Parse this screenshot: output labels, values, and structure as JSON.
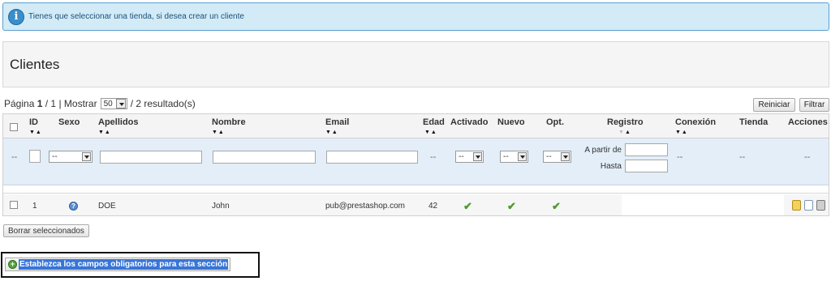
{
  "alert": {
    "icon": "info-icon",
    "text": "Tienes que seleccionar una tienda, si desea crear un cliente"
  },
  "page_title": "Clientes",
  "pagination": {
    "page_label": "Página",
    "current_page": "1",
    "total_pages": "/ 1",
    "separator": "|",
    "show_label": "Mostrar",
    "per_page": "50",
    "results": "/ 2 resultado(s)"
  },
  "toolbar": {
    "reset_label": "Reiniciar",
    "filter_label": "Filtrar"
  },
  "columns": {
    "id": "ID",
    "sex": "Sexo",
    "lastname": "Apellidos",
    "firstname": "Nombre",
    "email": "Email",
    "age": "Edad",
    "active": "Activado",
    "new": "Nuevo",
    "optin": "Opt.",
    "registration": "Registro",
    "connection": "Conexión",
    "shop": "Tienda",
    "actions": "Acciones"
  },
  "sort_arrows": "▼▲",
  "filters": {
    "dash": "--",
    "select_value": "--",
    "from_label": "A partir de",
    "to_label": "Hasta"
  },
  "rows": [
    {
      "id": "1",
      "sex_icon": "question-icon",
      "lastname": "DOE",
      "firstname": "John",
      "email": "pub@prestashop.com",
      "age": "42",
      "active_icon": "check-icon",
      "new_icon": "check-icon",
      "optin_icon": "check-icon",
      "check": "✔",
      "sex_glyph": "?"
    }
  ],
  "row_actions": [
    "edit-icon",
    "view-icon",
    "delete-icon"
  ],
  "bulk": {
    "delete_label": "Borrar seleccionados"
  },
  "required_fields": {
    "icon": "add-icon",
    "icon_glyph": "+",
    "label": "Establezca los campos obligatorios para esta sección"
  },
  "colors": {
    "alert_bg": "#d2ebf7",
    "filter_bg": "#e3eef8",
    "check": "#4d9a2a",
    "selection": "#3875d7"
  }
}
